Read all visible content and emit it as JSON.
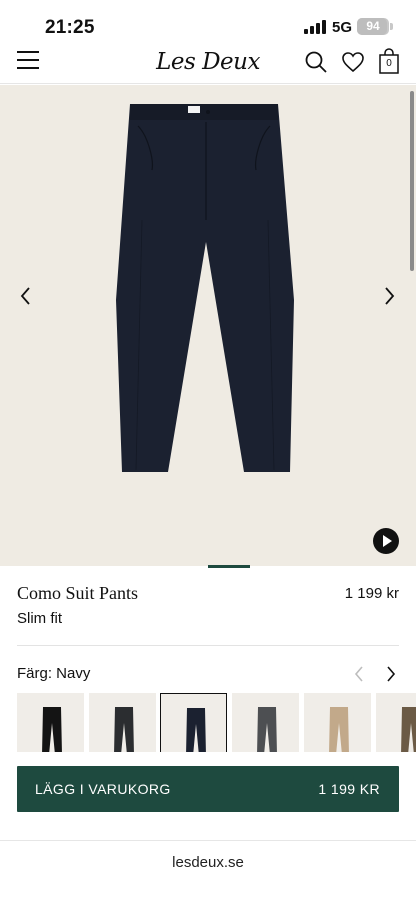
{
  "status_bar": {
    "time": "21:25",
    "network": "5G",
    "battery_level": "94"
  },
  "header": {
    "logo_text": "Les Deux",
    "bag_count": "0",
    "icons": [
      "menu-icon",
      "search-icon",
      "heart-icon",
      "bag-icon"
    ]
  },
  "product": {
    "name": "Como Suit Pants",
    "price": "1 199 kr",
    "fit": "Slim fit",
    "color_label": "Färg: Navy",
    "image_background": "#efebe3",
    "garment_color": "#1b2130"
  },
  "swatches": [
    {
      "color": "#141414",
      "selected": false
    },
    {
      "color": "#2b2d30",
      "selected": false
    },
    {
      "color": "#1b2130",
      "selected": true
    },
    {
      "color": "#4d4f52",
      "selected": false
    },
    {
      "color": "#c2a98a",
      "selected": false
    },
    {
      "color": "#6b5a45",
      "selected": false
    }
  ],
  "cart": {
    "button_label": "LÄGG I VARUKORG",
    "button_price": "1 199 KR",
    "accent_color": "#1e4a3f"
  },
  "browser": {
    "url": "lesdeux.se"
  }
}
